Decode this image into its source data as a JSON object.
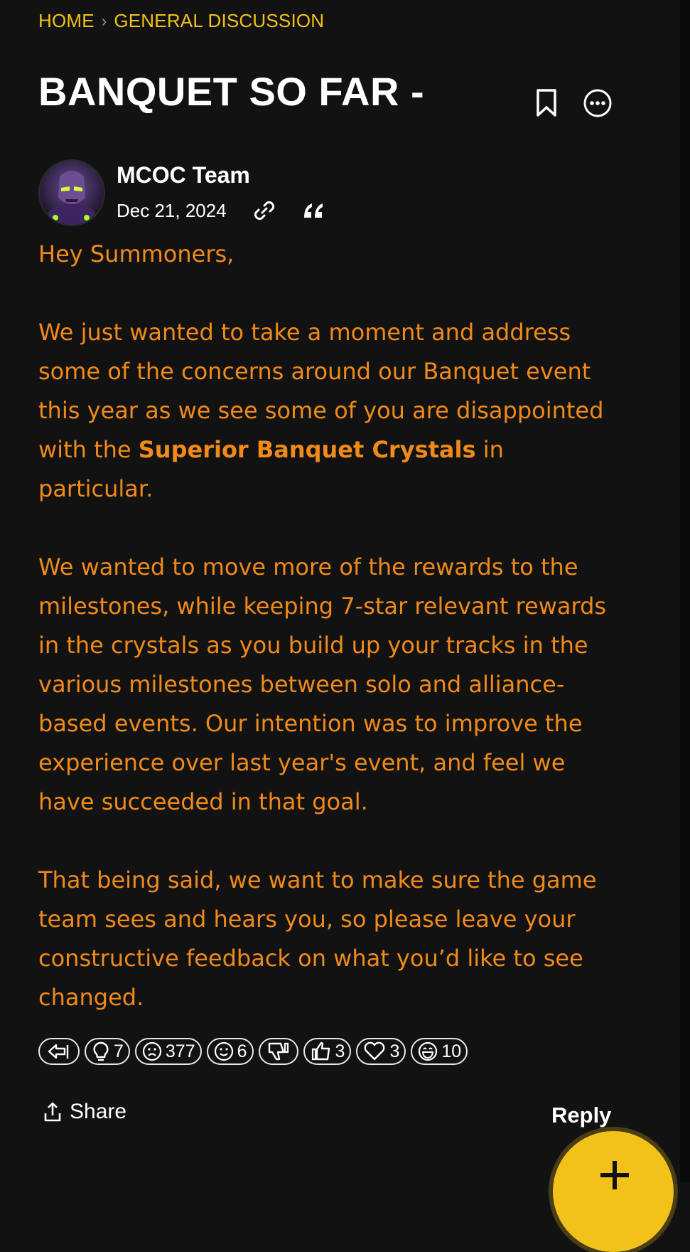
{
  "breadcrumb": {
    "home": "HOME",
    "separator": "›",
    "category": "GENERAL DISCUSSION"
  },
  "post": {
    "title": "BANQUET SO FAR -",
    "author": "MCOC Team",
    "date": "Dec 21, 2024",
    "body": {
      "p1": "Hey Summoners,",
      "p2_before": "We just wanted to take a moment and address some of the concerns around our Banquet event this year as we see some of you are disappointed with the ",
      "p2_bold": "Superior Banquet Crystals",
      "p2_after": " in particular.",
      "p3": "We wanted to move more of the rewards to the milestones, while keeping 7-star relevant rewards in the crystals as you build up your tracks in the various milestones between solo and alliance-based events. Our intention was to improve the experience over last year's event, and feel we have succeeded in that goal.",
      "p4": "That being said, we want to make sure the game team sees and hears you, so please leave your constructive feedback on what you’d like to see changed."
    }
  },
  "reactions": [
    {
      "icon": "insightful-arrow-icon",
      "count": ""
    },
    {
      "icon": "lightbulb-icon",
      "count": "7"
    },
    {
      "icon": "sad-face-icon",
      "count": "377"
    },
    {
      "icon": "smile-face-icon",
      "count": "6"
    },
    {
      "icon": "thumbs-down-icon",
      "count": ""
    },
    {
      "icon": "thumbs-up-icon",
      "count": "3"
    },
    {
      "icon": "heart-icon",
      "count": "3"
    },
    {
      "icon": "laugh-face-icon",
      "count": "10"
    }
  ],
  "actions": {
    "share": "Share",
    "reply": "Reply"
  },
  "colors": {
    "accent": "#f2c21a",
    "body_text": "#f08a1a",
    "background": "#121212"
  }
}
